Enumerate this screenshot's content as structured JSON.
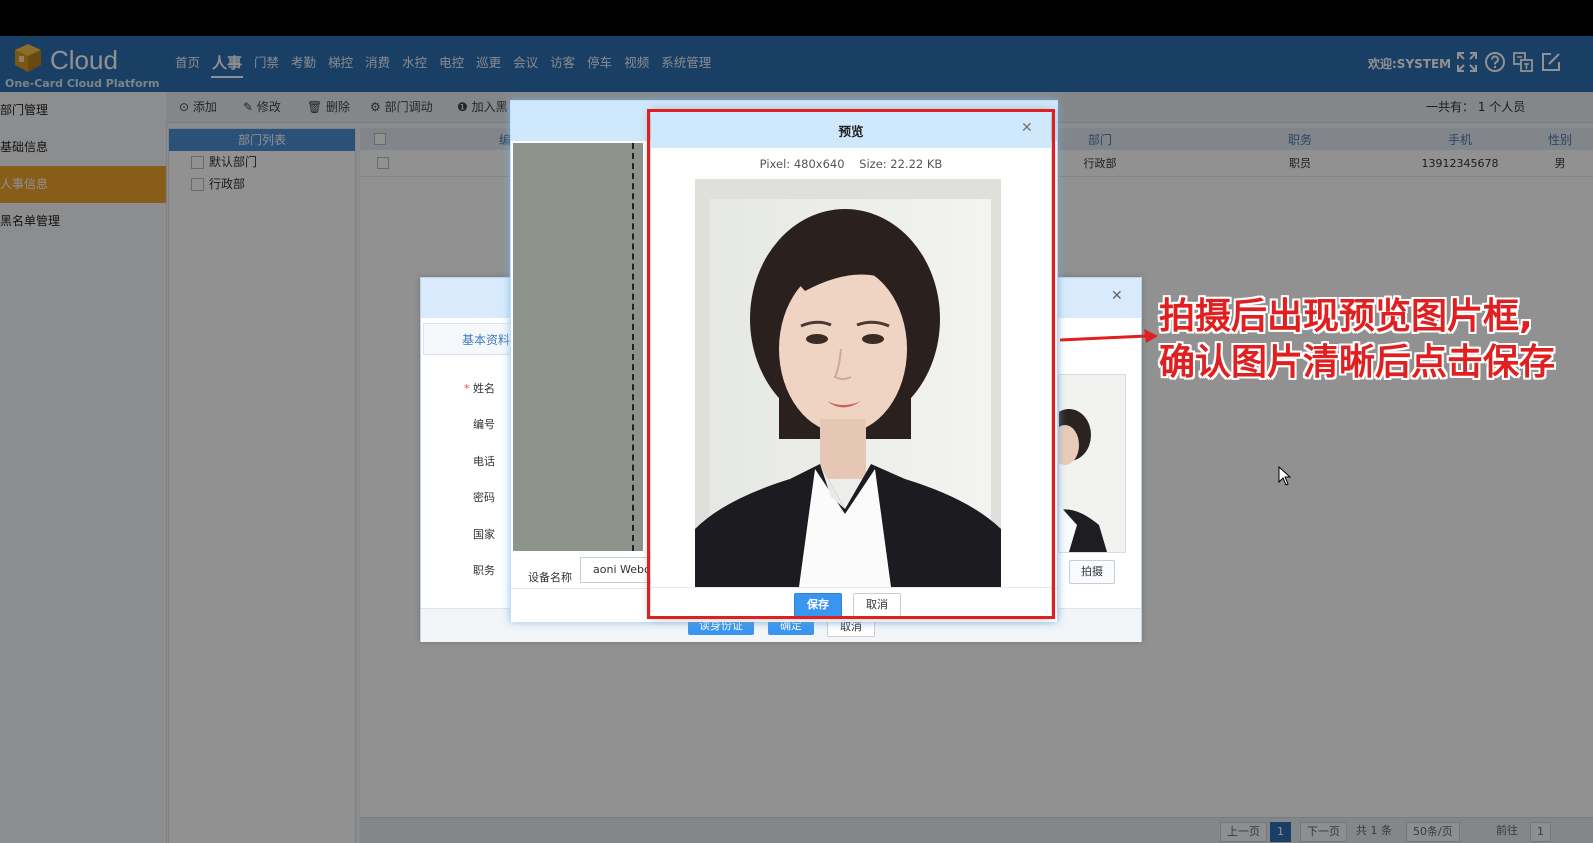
{
  "app": {
    "brand": "Cloud",
    "subtitle": "One-Card Cloud Platform",
    "welcome": "欢迎:SYSTEM"
  },
  "nav": [
    "首页",
    "人事",
    "门禁",
    "考勤",
    "梯控",
    "消费",
    "水控",
    "电控",
    "巡更",
    "会议",
    "访客",
    "停车",
    "视频",
    "系统管理"
  ],
  "nav_active_index": 1,
  "header_icons": [
    "fullscreen-icon",
    "help-icon",
    "translate-icon",
    "edit-external-icon"
  ],
  "sidebar": {
    "items": [
      "部门管理",
      "基础信息",
      "人事信息",
      "黑名单管理"
    ],
    "active_index": 2
  },
  "toolbar": {
    "add": "⊙ 添加",
    "edit": "✎ 修改",
    "delete": "🗑 删除",
    "transfer": "⚙ 部门调动",
    "blacklist": "❶ 加入黑",
    "count_label": "一共有：",
    "count_value": "1 个人员"
  },
  "dept_panel": {
    "title": "部门列表",
    "items": [
      "默认部门",
      "行政部"
    ]
  },
  "grid": {
    "headers": [
      "",
      "编",
      "部门",
      "职务",
      "手机",
      "性别"
    ],
    "row": {
      "dept": "行政部",
      "title": "职员",
      "phone": "13912345678",
      "gender": "男"
    }
  },
  "pager": {
    "prev": "上一页",
    "page": "1",
    "next": "下一页",
    "total": "共 1 条",
    "per_page": "50条/页",
    "goto": "前往",
    "goto_value": "1"
  },
  "employee_dialog": {
    "tab": "基本资料",
    "fields": [
      "姓名",
      "编号",
      "电话",
      "密码",
      "国家",
      "职务"
    ],
    "required_mark": "*",
    "shoot_button": "拍摄",
    "footer_buttons": [
      "读身份证",
      "确定",
      "取消"
    ]
  },
  "camera_dialog": {
    "device_label": "设备名称",
    "device_value": "aoni Webc"
  },
  "preview_dialog": {
    "title": "预览",
    "pixel_label": "Pixel:",
    "pixel_value": "480x640",
    "size_label": "Size:",
    "size_value": "22.22 KB",
    "save": "保存",
    "cancel": "取消"
  },
  "annotation": {
    "line1": "拍摄后出现预览图片框,",
    "line2": "确认图片清晰后点击保存",
    "color": "#e02020"
  },
  "colors": {
    "header_bg": "#2f6fb0",
    "sidebar_active": "#f0a32c",
    "primary_button": "#3a95f0"
  }
}
